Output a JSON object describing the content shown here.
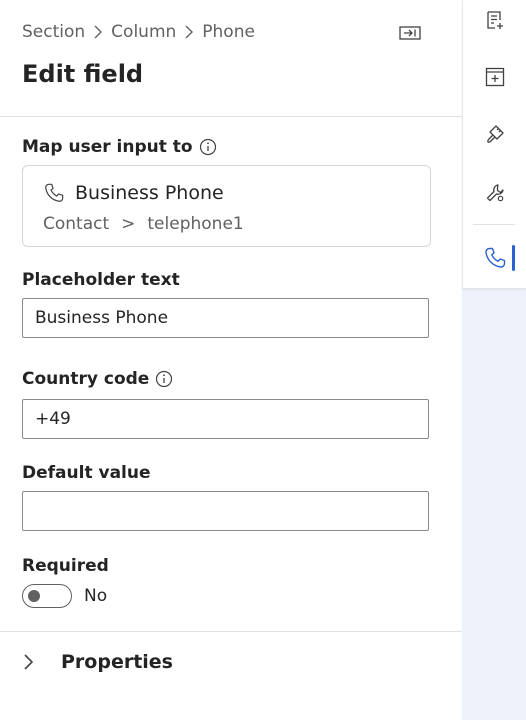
{
  "breadcrumb": {
    "items": [
      "Section",
      "Column",
      "Phone"
    ]
  },
  "header": {
    "title": "Edit field"
  },
  "map": {
    "label": "Map user input to",
    "field_name": "Business Phone",
    "entity": "Contact",
    "separator": ">",
    "attribute": "telephone1"
  },
  "placeholder": {
    "label": "Placeholder text",
    "value": "Business Phone"
  },
  "country_code": {
    "label": "Country code",
    "value": "+49"
  },
  "default_value": {
    "label": "Default value",
    "value": ""
  },
  "required": {
    "label": "Required",
    "state_text": "No",
    "on": false
  },
  "properties": {
    "label": "Properties",
    "expanded": false
  },
  "rail": {
    "items": [
      "add-field-icon",
      "add-section-icon",
      "style-brush-icon",
      "settings-wrench-icon",
      "phone-icon"
    ],
    "active": "phone-icon"
  },
  "colors": {
    "accent": "#2b61d1",
    "rail_background": "#eef2fb"
  }
}
